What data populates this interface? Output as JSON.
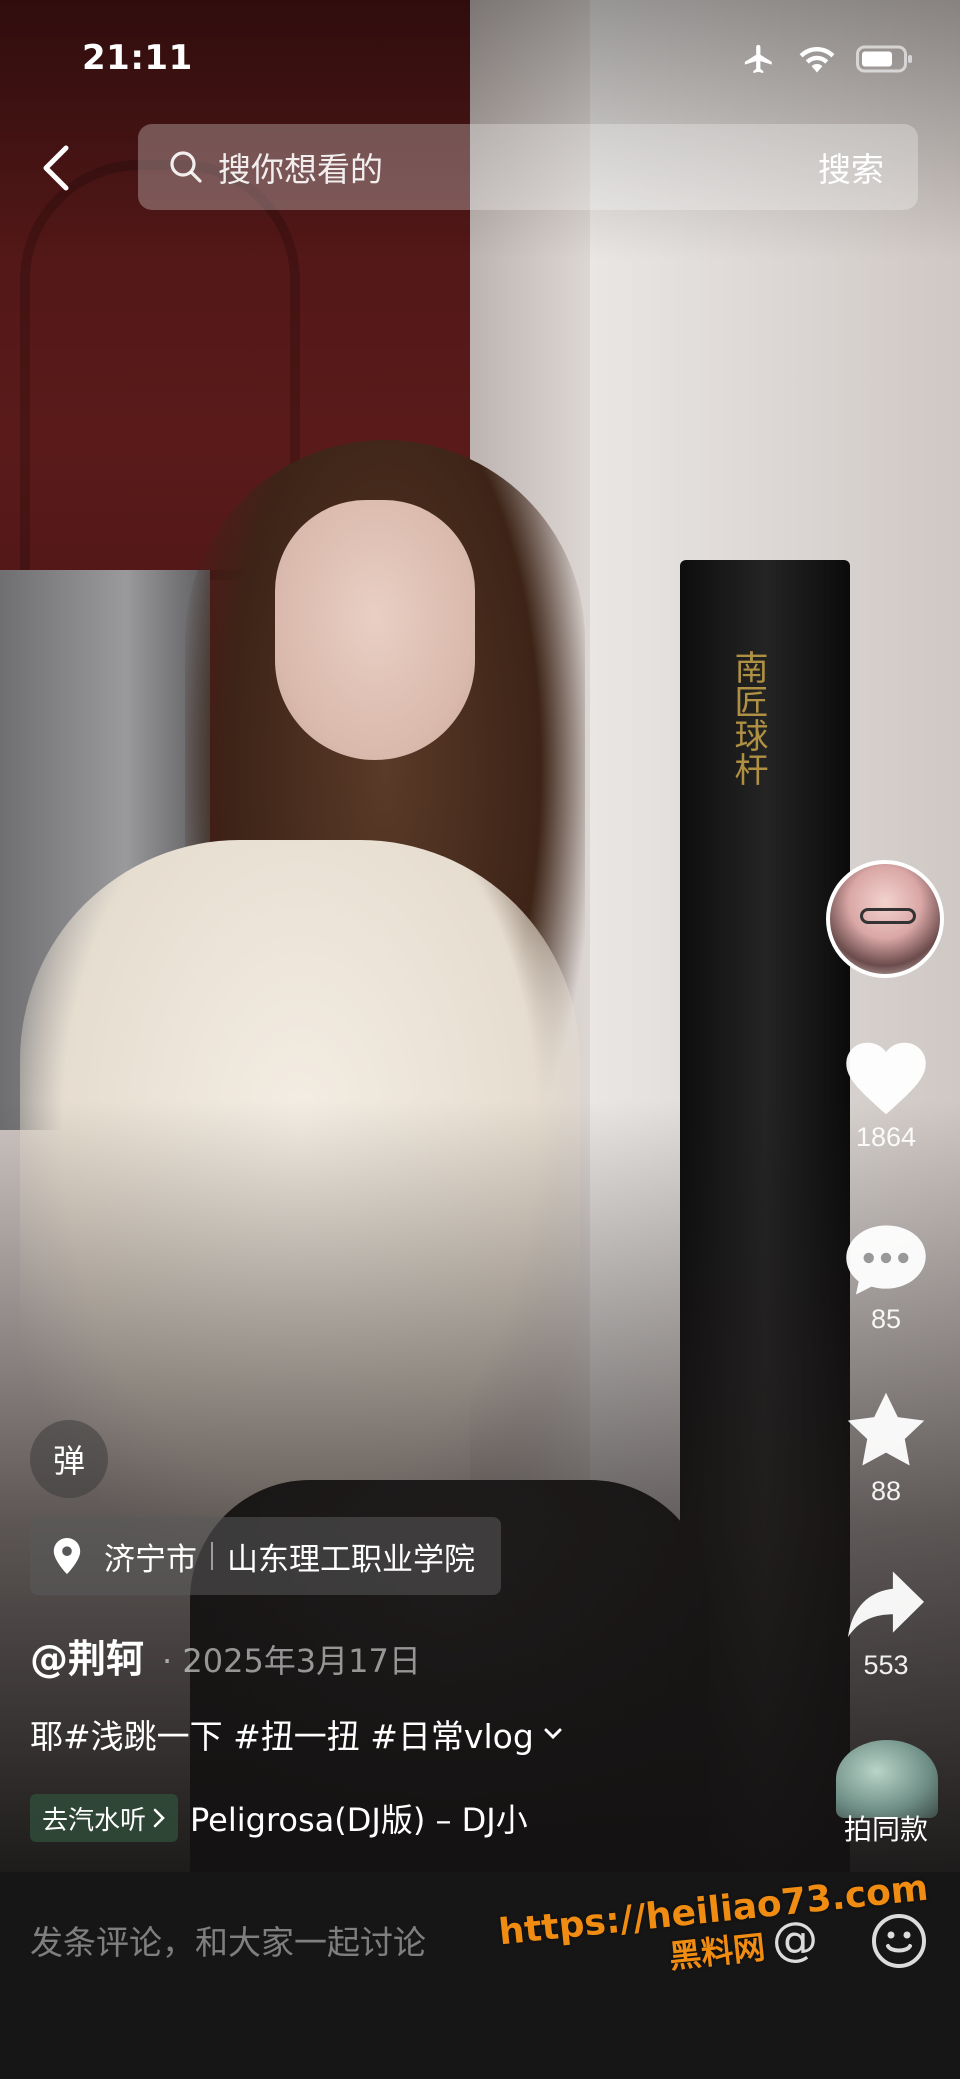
{
  "status_bar": {
    "time": "21:11"
  },
  "header": {
    "search_placeholder": "搜你想看的",
    "search_button": "搜索"
  },
  "actions": {
    "like_count": "1864",
    "comment_count": "85",
    "favorite_count": "88",
    "share_count": "553",
    "same_style_label": "拍同款"
  },
  "danmaku": {
    "label": "弹"
  },
  "location": {
    "city": "济宁市",
    "place": "山东理工职业学院"
  },
  "post": {
    "author": "@荆轲",
    "date": "· 2025年3月17日",
    "caption": "耶#浅跳一下 #扭一扭 #日常vlog",
    "music_tag": "去汽水听",
    "music_title": "Peligrosa(DJ版) – DJ小"
  },
  "comment_bar": {
    "placeholder": "发条评论，和大家一起讨论"
  },
  "watermark": {
    "url": "https://heiliao73.com",
    "name": "黑料网"
  },
  "background_text": "南匠球杆",
  "colors": {
    "watermark": "#f08c12",
    "comment_bar_bg": "#161616"
  }
}
